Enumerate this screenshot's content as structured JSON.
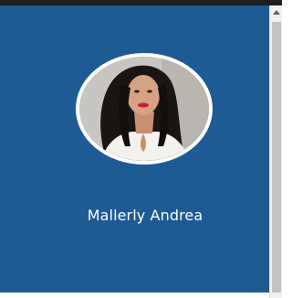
{
  "profile": {
    "name": "Mallerly Andrea",
    "avatar_icon": "profile-photo"
  },
  "colors": {
    "panel_bg": "#1e5a94",
    "ring": "#ffffff",
    "text": "#ffffff"
  },
  "scrollbar": {
    "up_icon": "chevron-up-icon"
  }
}
